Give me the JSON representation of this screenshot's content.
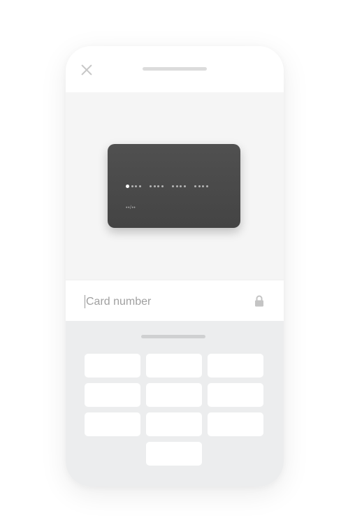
{
  "header": {
    "close_icon": "close-icon"
  },
  "card": {
    "number_placeholder": [
      "••••",
      "••••",
      "••••",
      "••••"
    ],
    "expiry_placeholder": "••/••",
    "color": "#4a4a4a"
  },
  "input": {
    "placeholder": "Card number",
    "value": "",
    "lock_icon": "lock-icon"
  },
  "keypad": {
    "key_count": 10,
    "background": "#ecedee"
  },
  "colors": {
    "card_area_bg": "#f5f5f5",
    "placeholder_text": "#a0a0a0",
    "handle": "#dcdcdc"
  }
}
